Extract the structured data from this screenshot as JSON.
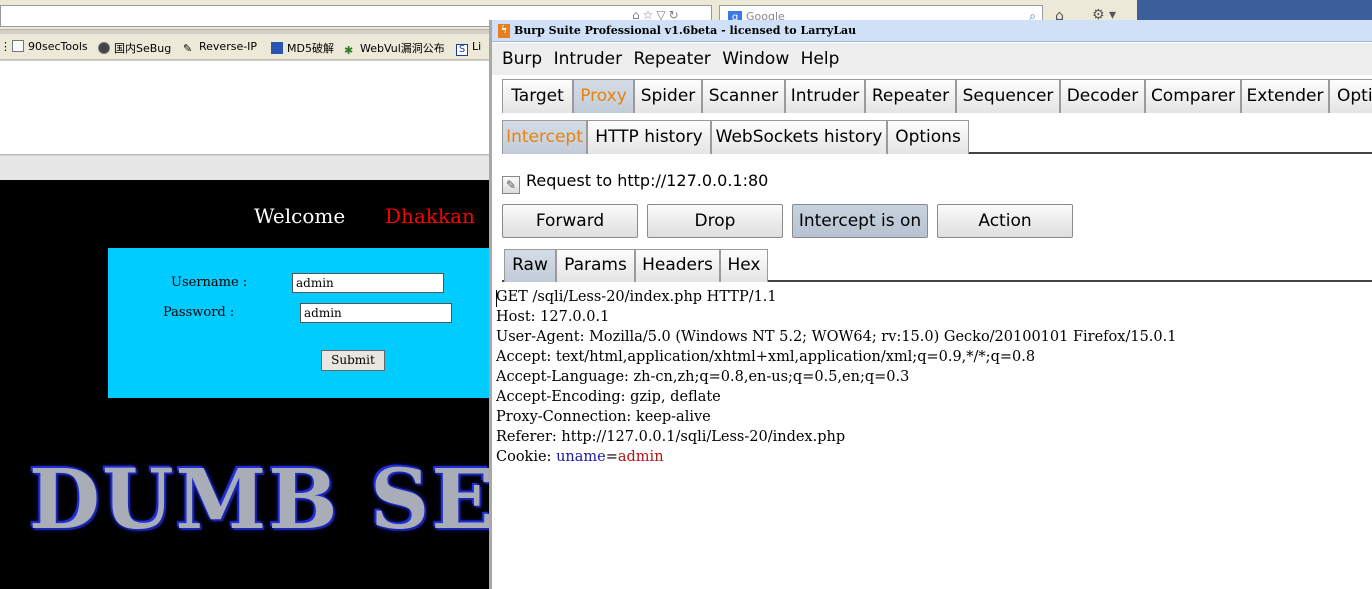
{
  "browser": {
    "search_placeholder": "Google",
    "bookmarks": [
      "90secTools",
      "国内SeBug",
      "Reverse-IP",
      "MD5破解",
      "WebVul漏洞公布",
      "Li"
    ],
    "page": {
      "welcome": "Welcome",
      "name": "Dhakkan",
      "username_label": "Username :",
      "password_label": "Password :",
      "username_value": "admin",
      "password_value": "admin",
      "submit_label": "Submit",
      "banner": "I DUMB SE"
    }
  },
  "burp": {
    "title": "Burp Suite Professional v1.6beta - licensed to LarryLau",
    "menu": [
      "Burp",
      "Intruder",
      "Repeater",
      "Window",
      "Help"
    ],
    "main_tabs": [
      "Target",
      "Proxy",
      "Spider",
      "Scanner",
      "Intruder",
      "Repeater",
      "Sequencer",
      "Decoder",
      "Comparer",
      "Extender",
      "Optio"
    ],
    "sub_tabs": [
      "Intercept",
      "HTTP history",
      "WebSockets history",
      "Options"
    ],
    "request_to": "Request to http://127.0.0.1:80",
    "buttons": [
      "Forward",
      "Drop",
      "Intercept is on",
      "Action"
    ],
    "message_tabs": [
      "Raw",
      "Params",
      "Headers",
      "Hex"
    ],
    "raw_lines": [
      "GET /sqli/Less-20/index.php HTTP/1.1",
      "Host: 127.0.0.1",
      "User-Agent: Mozilla/5.0 (Windows NT 5.2; WOW64; rv:15.0) Gecko/20100101 Firefox/15.0.1",
      "Accept: text/html,application/xhtml+xml,application/xml;q=0.9,*/*;q=0.8",
      "Accept-Language: zh-cn,zh;q=0.8,en-us;q=0.5,en;q=0.3",
      "Accept-Encoding: gzip, deflate",
      "Proxy-Connection: keep-alive",
      "Referer: http://127.0.0.1/sqli/Less-20/index.php"
    ],
    "cookie": {
      "prefix": "Cookie: ",
      "name": "uname",
      "eq": "=",
      "value": "admin"
    },
    "colors": {
      "selected_tab_text": "#e8820e",
      "cookie_name": "#1a1aa6",
      "cookie_value": "#b31313"
    }
  }
}
